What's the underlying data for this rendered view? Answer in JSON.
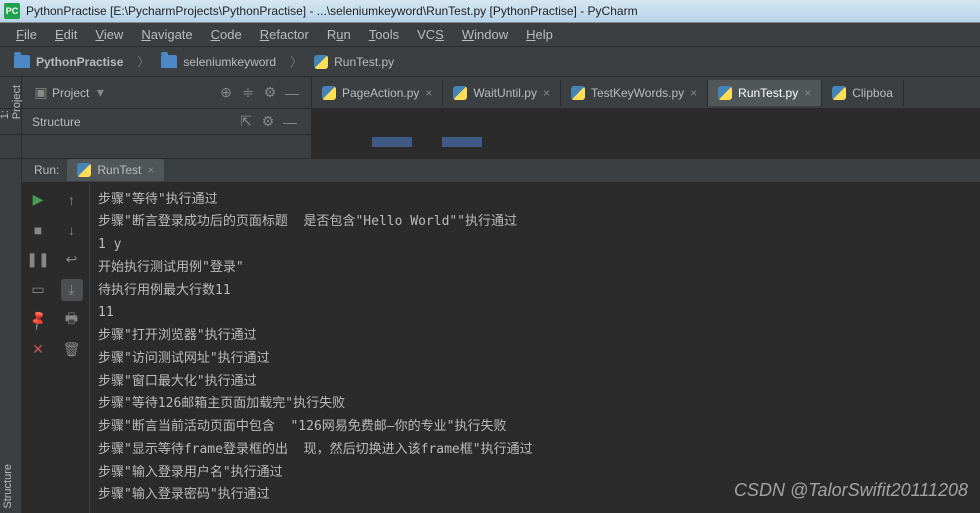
{
  "titlebar": {
    "icon_label": "PC",
    "text": "PythonPractise [E:\\PycharmProjects\\PythonPractise] - ...\\seleniumkeyword\\RunTest.py [PythonPractise] - PyCharm"
  },
  "menubar": [
    {
      "label": "File",
      "mn": "F",
      "rest": "ile"
    },
    {
      "label": "Edit",
      "mn": "E",
      "rest": "dit"
    },
    {
      "label": "View",
      "mn": "V",
      "rest": "iew"
    },
    {
      "label": "Navigate",
      "mn": "N",
      "rest": "avigate"
    },
    {
      "label": "Code",
      "mn": "C",
      "rest": "ode"
    },
    {
      "label": "Refactor",
      "mn": "R",
      "rest": "efactor"
    },
    {
      "label": "Run",
      "mn": "u",
      "pre": "R",
      "rest": "n"
    },
    {
      "label": "Tools",
      "mn": "T",
      "rest": "ools"
    },
    {
      "label": "VCS",
      "mn": "S",
      "pre": "VC",
      "rest": ""
    },
    {
      "label": "Window",
      "mn": "W",
      "rest": "indow"
    },
    {
      "label": "Help",
      "mn": "H",
      "rest": "elp"
    }
  ],
  "breadcrumb": [
    {
      "icon": "folder",
      "label": "PythonPractise",
      "bold": true
    },
    {
      "icon": "folder",
      "label": "seleniumkeyword"
    },
    {
      "icon": "python",
      "label": "RunTest.py"
    }
  ],
  "project_panel": {
    "label": "Project"
  },
  "structure_panel": {
    "label": "Structure"
  },
  "tabs": [
    {
      "label": "PageAction.py",
      "active": false
    },
    {
      "label": "WaitUntil.py",
      "active": false
    },
    {
      "label": "TestKeyWords.py",
      "active": false
    },
    {
      "label": "RunTest.py",
      "active": true
    },
    {
      "label": "Clipboa",
      "active": false,
      "noclose": true
    }
  ],
  "side_tabs": {
    "left_top": "1: Project",
    "left_bottom": "Structure"
  },
  "run": {
    "label": "Run:",
    "tab": "RunTest",
    "lines": [
      "步骤\"等待\"执行通过",
      "步骤\"断言登录成功后的页面标题  是否包含\"Hello World\"\"执行通过",
      "1 y",
      "开始执行测试用例\"登录\"",
      "待执行用例最大行数11",
      "11",
      "步骤\"打开浏览器\"执行通过",
      "步骤\"访问测试网址\"执行通过",
      "步骤\"窗口最大化\"执行通过",
      "步骤\"等待126邮箱主页面加载完\"执行失败",
      "步骤\"断言当前活动页面中包含  \"126网易免费邮—你的专业\"执行失败",
      "步骤\"显示等待frame登录框的出  现，然后切换进入该frame框\"执行通过",
      "步骤\"输入登录用户名\"执行通过",
      "步骤\"输入登录密码\"执行通过"
    ]
  },
  "watermark": "CSDN @TalorSwifit20111208",
  "icons": {
    "close": "×",
    "dropdown": "▾",
    "gear": "⚙",
    "collapse": "⇱",
    "hide": "—",
    "play": "▶",
    "stop": "■",
    "pause": "❚❚",
    "up": "↑",
    "down": "↓",
    "trash": "🗑",
    "pin": "📌",
    "x": "✕",
    "layout": "▭",
    "wrap": "↩",
    "print": "🖶",
    "scroll": "⤓"
  }
}
